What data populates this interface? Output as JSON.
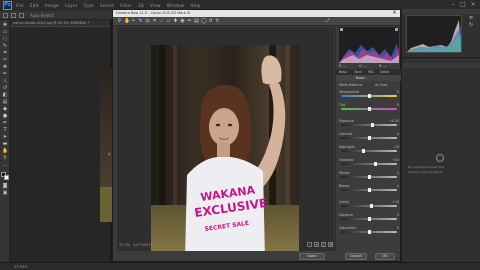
{
  "app": {
    "logo": "Ps",
    "menu_items": [
      "File",
      "Edit",
      "Image",
      "Layer",
      "Type",
      "Select",
      "Filter",
      "3D",
      "View",
      "Window",
      "Help"
    ],
    "options_label": "Auto-Select:"
  },
  "document_tab": {
    "label": "nanny-photo-0101.jpg @ 33.3% (RGB/8#) *"
  },
  "camera_raw": {
    "title": "Camera Raw 11.0 - Canon EOS 5D Mark III",
    "status_left": "33.3%",
    "status_mid": "4477x5970",
    "buttons": {
      "open": "Open",
      "cancel": "Cancel",
      "ok": "OK"
    },
    "histogram_meta": [
      "R: ---",
      "G: ---",
      "B: ---"
    ],
    "panel_tabs": [
      "Basic",
      "Tone",
      "HSL",
      "Detail"
    ],
    "section_title": "Basic",
    "white_balance": {
      "label": "White Balance:",
      "value": "As Shot"
    },
    "sliders": [
      {
        "name": "Temperature",
        "value": "0"
      },
      {
        "name": "Tint",
        "value": "0"
      },
      {
        "name": "Exposure",
        "value": "+0.35"
      },
      {
        "name": "Contrast",
        "value": "0"
      },
      {
        "name": "Highlights",
        "value": "-19"
      },
      {
        "name": "Shadows",
        "value": "+24"
      },
      {
        "name": "Whites",
        "value": "0"
      },
      {
        "name": "Blacks",
        "value": "0"
      },
      {
        "name": "Clarity",
        "value": "+10"
      },
      {
        "name": "Vibrance",
        "value": "0"
      },
      {
        "name": "Saturation",
        "value": "0"
      }
    ],
    "slider_positions": [
      0.5,
      0.5,
      0.56,
      0.5,
      0.4,
      0.62,
      0.5,
      0.5,
      0.55,
      0.5,
      0.5
    ]
  },
  "photo": {
    "shirt_line1": "WAKANA",
    "shirt_line2": "EXCLUSIVE",
    "shirt_line3": "SECRET SALE"
  },
  "right_panel": {
    "message_line1": "No adjustment selected",
    "message_line2": "Select a layer to adjust"
  },
  "status": {
    "zoom": "33.33%"
  },
  "colors": {
    "accent": "#2ea0ff",
    "shirt_print": "#c2178a"
  }
}
